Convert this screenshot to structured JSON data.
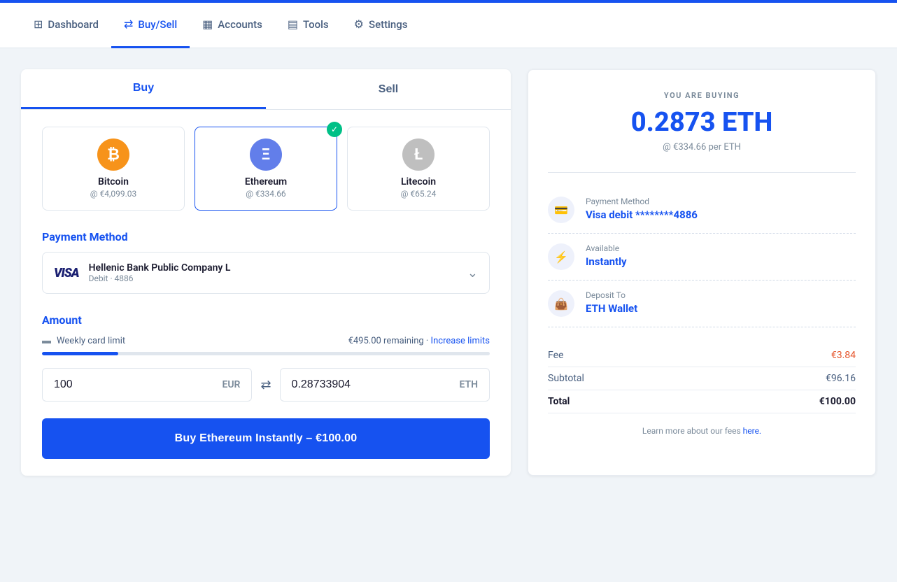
{
  "topAccent": true,
  "nav": {
    "items": [
      {
        "id": "dashboard",
        "label": "Dashboard",
        "icon": "⊞",
        "active": false
      },
      {
        "id": "buysell",
        "label": "Buy/Sell",
        "icon": "⇄",
        "active": true
      },
      {
        "id": "accounts",
        "label": "Accounts",
        "icon": "▦",
        "active": false
      },
      {
        "id": "tools",
        "label": "Tools",
        "icon": "▤",
        "active": false
      },
      {
        "id": "settings",
        "label": "Settings",
        "icon": "⚙",
        "active": false
      }
    ]
  },
  "tabs": {
    "buy_label": "Buy",
    "sell_label": "Sell",
    "active": "buy"
  },
  "coins": [
    {
      "id": "bitcoin",
      "name": "Bitcoin",
      "price": "@ €4,099.03",
      "iconClass": "btc",
      "symbol": "₿",
      "selected": false
    },
    {
      "id": "ethereum",
      "name": "Ethereum",
      "price": "@ €334.66",
      "iconClass": "eth",
      "symbol": "Ξ",
      "selected": true
    },
    {
      "id": "litecoin",
      "name": "Litecoin",
      "price": "@ €65.24",
      "iconClass": "ltc",
      "symbol": "Ł",
      "selected": false
    }
  ],
  "payment": {
    "section_label": "Payment Method",
    "visa_logo": "VISA",
    "bank_name": "Hellenic Bank Public Company L",
    "card_sub": "Debit · 4886"
  },
  "amount": {
    "section_label": "Amount",
    "weekly_limit_label": "Weekly card limit",
    "remaining_text": "€495.00 remaining",
    "remaining_dot": "·",
    "increase_label": "Increase limits",
    "progress_percent": 17,
    "eur_value": "100",
    "eth_value": "0.28733904",
    "eur_currency": "EUR",
    "eth_currency": "ETH"
  },
  "buy_button": {
    "label": "Buy Ethereum Instantly – €100.00"
  },
  "summary": {
    "you_are_buying": "YOU ARE BUYING",
    "big_amount": "0.2873 ETH",
    "per_price": "@ €334.66 per ETH",
    "payment_title": "Payment Method",
    "payment_value": "Visa debit ********4886",
    "available_title": "Available",
    "available_value": "Instantly",
    "deposit_title": "Deposit To",
    "deposit_value": "ETH Wallet",
    "fee_label": "Fee",
    "fee_value": "€3.84",
    "subtotal_label": "Subtotal",
    "subtotal_value": "€96.16",
    "total_label": "Total",
    "total_value": "€100.00",
    "learn_more_text": "Learn more about our fees",
    "learn_more_link": "here."
  }
}
